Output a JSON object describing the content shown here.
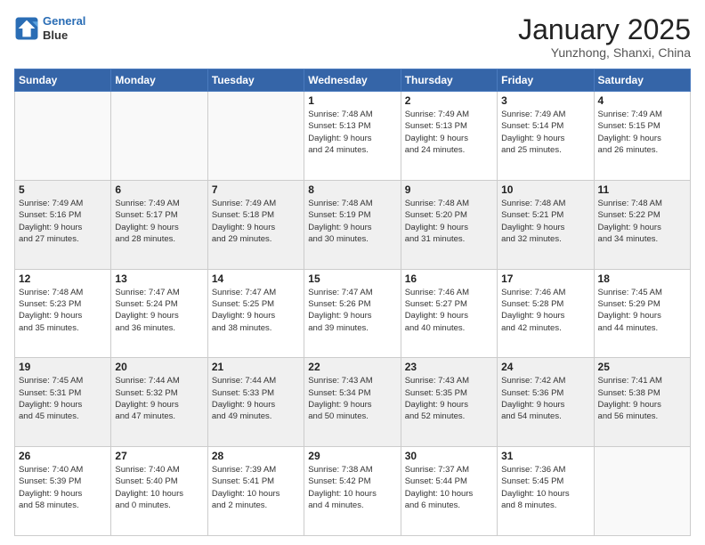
{
  "logo": {
    "line1": "General",
    "line2": "Blue"
  },
  "title": "January 2025",
  "subtitle": "Yunzhong, Shanxi, China",
  "days_of_week": [
    "Sunday",
    "Monday",
    "Tuesday",
    "Wednesday",
    "Thursday",
    "Friday",
    "Saturday"
  ],
  "weeks": [
    [
      {
        "day": "",
        "info": ""
      },
      {
        "day": "",
        "info": ""
      },
      {
        "day": "",
        "info": ""
      },
      {
        "day": "1",
        "info": "Sunrise: 7:48 AM\nSunset: 5:13 PM\nDaylight: 9 hours\nand 24 minutes."
      },
      {
        "day": "2",
        "info": "Sunrise: 7:49 AM\nSunset: 5:13 PM\nDaylight: 9 hours\nand 24 minutes."
      },
      {
        "day": "3",
        "info": "Sunrise: 7:49 AM\nSunset: 5:14 PM\nDaylight: 9 hours\nand 25 minutes."
      },
      {
        "day": "4",
        "info": "Sunrise: 7:49 AM\nSunset: 5:15 PM\nDaylight: 9 hours\nand 26 minutes."
      }
    ],
    [
      {
        "day": "5",
        "info": "Sunrise: 7:49 AM\nSunset: 5:16 PM\nDaylight: 9 hours\nand 27 minutes."
      },
      {
        "day": "6",
        "info": "Sunrise: 7:49 AM\nSunset: 5:17 PM\nDaylight: 9 hours\nand 28 minutes."
      },
      {
        "day": "7",
        "info": "Sunrise: 7:49 AM\nSunset: 5:18 PM\nDaylight: 9 hours\nand 29 minutes."
      },
      {
        "day": "8",
        "info": "Sunrise: 7:48 AM\nSunset: 5:19 PM\nDaylight: 9 hours\nand 30 minutes."
      },
      {
        "day": "9",
        "info": "Sunrise: 7:48 AM\nSunset: 5:20 PM\nDaylight: 9 hours\nand 31 minutes."
      },
      {
        "day": "10",
        "info": "Sunrise: 7:48 AM\nSunset: 5:21 PM\nDaylight: 9 hours\nand 32 minutes."
      },
      {
        "day": "11",
        "info": "Sunrise: 7:48 AM\nSunset: 5:22 PM\nDaylight: 9 hours\nand 34 minutes."
      }
    ],
    [
      {
        "day": "12",
        "info": "Sunrise: 7:48 AM\nSunset: 5:23 PM\nDaylight: 9 hours\nand 35 minutes."
      },
      {
        "day": "13",
        "info": "Sunrise: 7:47 AM\nSunset: 5:24 PM\nDaylight: 9 hours\nand 36 minutes."
      },
      {
        "day": "14",
        "info": "Sunrise: 7:47 AM\nSunset: 5:25 PM\nDaylight: 9 hours\nand 38 minutes."
      },
      {
        "day": "15",
        "info": "Sunrise: 7:47 AM\nSunset: 5:26 PM\nDaylight: 9 hours\nand 39 minutes."
      },
      {
        "day": "16",
        "info": "Sunrise: 7:46 AM\nSunset: 5:27 PM\nDaylight: 9 hours\nand 40 minutes."
      },
      {
        "day": "17",
        "info": "Sunrise: 7:46 AM\nSunset: 5:28 PM\nDaylight: 9 hours\nand 42 minutes."
      },
      {
        "day": "18",
        "info": "Sunrise: 7:45 AM\nSunset: 5:29 PM\nDaylight: 9 hours\nand 44 minutes."
      }
    ],
    [
      {
        "day": "19",
        "info": "Sunrise: 7:45 AM\nSunset: 5:31 PM\nDaylight: 9 hours\nand 45 minutes."
      },
      {
        "day": "20",
        "info": "Sunrise: 7:44 AM\nSunset: 5:32 PM\nDaylight: 9 hours\nand 47 minutes."
      },
      {
        "day": "21",
        "info": "Sunrise: 7:44 AM\nSunset: 5:33 PM\nDaylight: 9 hours\nand 49 minutes."
      },
      {
        "day": "22",
        "info": "Sunrise: 7:43 AM\nSunset: 5:34 PM\nDaylight: 9 hours\nand 50 minutes."
      },
      {
        "day": "23",
        "info": "Sunrise: 7:43 AM\nSunset: 5:35 PM\nDaylight: 9 hours\nand 52 minutes."
      },
      {
        "day": "24",
        "info": "Sunrise: 7:42 AM\nSunset: 5:36 PM\nDaylight: 9 hours\nand 54 minutes."
      },
      {
        "day": "25",
        "info": "Sunrise: 7:41 AM\nSunset: 5:38 PM\nDaylight: 9 hours\nand 56 minutes."
      }
    ],
    [
      {
        "day": "26",
        "info": "Sunrise: 7:40 AM\nSunset: 5:39 PM\nDaylight: 9 hours\nand 58 minutes."
      },
      {
        "day": "27",
        "info": "Sunrise: 7:40 AM\nSunset: 5:40 PM\nDaylight: 10 hours\nand 0 minutes."
      },
      {
        "day": "28",
        "info": "Sunrise: 7:39 AM\nSunset: 5:41 PM\nDaylight: 10 hours\nand 2 minutes."
      },
      {
        "day": "29",
        "info": "Sunrise: 7:38 AM\nSunset: 5:42 PM\nDaylight: 10 hours\nand 4 minutes."
      },
      {
        "day": "30",
        "info": "Sunrise: 7:37 AM\nSunset: 5:44 PM\nDaylight: 10 hours\nand 6 minutes."
      },
      {
        "day": "31",
        "info": "Sunrise: 7:36 AM\nSunset: 5:45 PM\nDaylight: 10 hours\nand 8 minutes."
      },
      {
        "day": "",
        "info": ""
      }
    ]
  ]
}
